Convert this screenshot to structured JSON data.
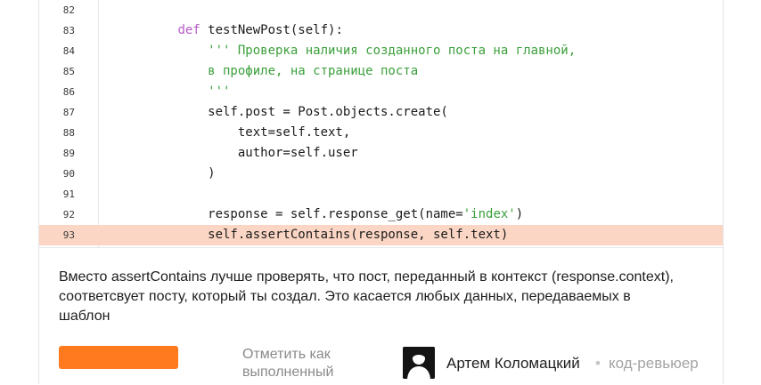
{
  "code": {
    "lines": [
      {
        "num": "82",
        "parts": [
          {
            "t": "",
            "c": ""
          }
        ]
      },
      {
        "num": "83",
        "parts": [
          {
            "t": "        ",
            "c": ""
          },
          {
            "t": "def",
            "c": "kw"
          },
          {
            "t": " testNewPost(self):",
            "c": ""
          }
        ]
      },
      {
        "num": "84",
        "parts": [
          {
            "t": "            ''' Проверка наличия созданного поста на главной,",
            "c": "str"
          }
        ]
      },
      {
        "num": "85",
        "parts": [
          {
            "t": "            в профиле, на странице поста",
            "c": "str"
          }
        ]
      },
      {
        "num": "86",
        "parts": [
          {
            "t": "            '''",
            "c": "str"
          }
        ]
      },
      {
        "num": "87",
        "parts": [
          {
            "t": "            self.post = Post.objects.create(",
            "c": ""
          }
        ]
      },
      {
        "num": "88",
        "parts": [
          {
            "t": "                text=self.text,",
            "c": ""
          }
        ]
      },
      {
        "num": "89",
        "parts": [
          {
            "t": "                author=self.user",
            "c": ""
          }
        ]
      },
      {
        "num": "90",
        "parts": [
          {
            "t": "            )",
            "c": ""
          }
        ]
      },
      {
        "num": "91",
        "parts": [
          {
            "t": "",
            "c": ""
          }
        ]
      },
      {
        "num": "92",
        "parts": [
          {
            "t": "            response = self.response_get(name=",
            "c": ""
          },
          {
            "t": "'index'",
            "c": "str"
          },
          {
            "t": ")",
            "c": ""
          }
        ]
      },
      {
        "num": "93",
        "highlight": true,
        "parts": [
          {
            "t": "            self.assertContains(response, self.text)",
            "c": ""
          }
        ]
      }
    ]
  },
  "review": {
    "comment": "Вместо assertContains лучше проверять, что пост, переданный в контекст (response.context), соответсвует посту, который ты создал. Это касается любых данных, передаваемых в шаблон",
    "mark_done_label": "Отметить как выполненный",
    "reviewer_name": "Артем Коломацкий",
    "separator": "•",
    "reviewer_role": "код-ревьюер"
  },
  "colors": {
    "accent_button": "#ff7a1f",
    "highlight_row": "#fbd6c4",
    "keyword": "#b75dc9",
    "string": "#3b9f3b"
  },
  "icons": {
    "avatar": "user-silhouette-icon"
  }
}
